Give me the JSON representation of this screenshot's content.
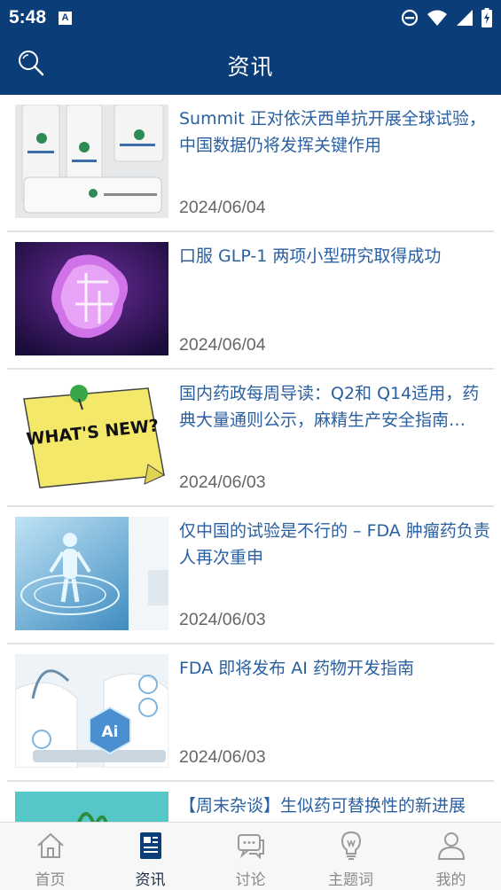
{
  "status_bar": {
    "time": "5:48",
    "notification_badge": "A"
  },
  "header": {
    "title": "资讯"
  },
  "articles": [
    {
      "title": "Summit 正对依沃西单抗开展全球试验，中国数据仍将发挥关键作用",
      "date": "2024/06/04"
    },
    {
      "title": "口服 GLP-1 两项小型研究取得成功",
      "date": "2024/06/04"
    },
    {
      "title": "国内药政每周导读：Q2和 Q14适用，药典大量通则公示，麻精生产安全指南…",
      "date": "2024/06/03",
      "thumb_text": "WHAT'S NEW?"
    },
    {
      "title": "仅中国的试验是不行的 – FDA 肿瘤药负责人再次重申",
      "date": "2024/06/03"
    },
    {
      "title": "FDA 即将发布 AI 药物开发指南",
      "date": "2024/06/03",
      "thumb_text": "Ai"
    },
    {
      "title": "【周末杂谈】生似药可替换性的新进展",
      "date": ""
    }
  ],
  "tabs": [
    {
      "label": "首页",
      "icon": "home-icon",
      "active": false
    },
    {
      "label": "资讯",
      "icon": "news-icon",
      "active": true
    },
    {
      "label": "讨论",
      "icon": "chat-icon",
      "active": false
    },
    {
      "label": "主题词",
      "icon": "lightbulb-icon",
      "active": false
    },
    {
      "label": "我的",
      "icon": "user-icon",
      "active": false
    }
  ],
  "colors": {
    "primary": "#0b3d78",
    "link": "#2a5fa0",
    "date": "#666666",
    "tab_inactive": "#8a8a8a"
  }
}
